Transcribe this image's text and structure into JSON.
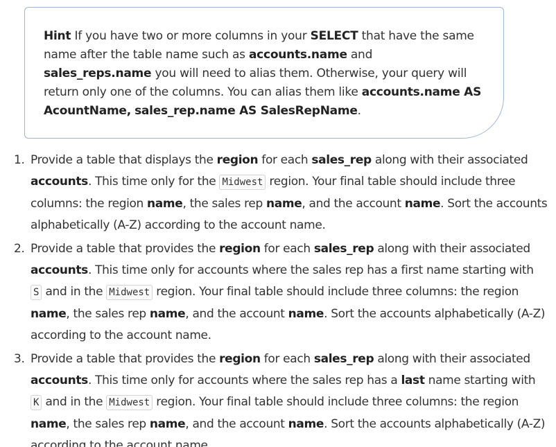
{
  "hint": {
    "label": "Hint",
    "t1": " If you have two or more columns in your ",
    "b1": "SELECT",
    "t2": " that have the same name after the table name such as ",
    "b2": "accounts.name",
    "t3": " and ",
    "b3": "sales_reps.name",
    "t4": " you will need to alias them. Otherwise, your query will return only one of the columns. You can alias them like ",
    "b4": "accounts.name AS AcountName,",
    "t5": " ",
    "b5": "sales_rep.name AS SalesRepName",
    "t6": "."
  },
  "tasks": [
    {
      "num": "1.",
      "p1": "Provide a table that displays the ",
      "b1": "region",
      "p2": " for each ",
      "b2": "sales_rep",
      "p3": " along with their associated ",
      "b3": "accounts",
      "p4": ". This time only for the ",
      "c1": "Midwest",
      "p5": " region. Your final table should include three columns: the region ",
      "b4": "name",
      "p6": ", the sales rep ",
      "b5": "name",
      "p7": ", and the account ",
      "b6": "name",
      "p8": ". Sort the accounts alphabetically (A-Z) according to the account name."
    },
    {
      "num": "2.",
      "p1": "Provide a table that provides the ",
      "b1": "region",
      "p2": " for each ",
      "b2": "sales_rep",
      "p3": " along with their associated ",
      "b3": "accounts",
      "p4": ". This time only for accounts where the sales rep has a first name starting with ",
      "c1": "S",
      "p5": " and in the ",
      "c2": "Midwest",
      "p6": " region. Your final table should include three columns: the region ",
      "b4": "name",
      "p7": ", the sales rep ",
      "b5": "name",
      "p8": ", and the account ",
      "b6": "name",
      "p9": ". Sort the accounts alphabetically (A-Z) according to the account name."
    },
    {
      "num": "3.",
      "p1": "Provide a table that provides the ",
      "b1": "region",
      "p2": " for each ",
      "b2": "sales_rep",
      "p3": " along with their associated ",
      "b3": "accounts",
      "p4": ". This time only for accounts where the sales rep has a ",
      "b4": "last",
      "p5": " name starting with ",
      "c1": "K",
      "p6": " and in the ",
      "c2": "Midwest",
      "p7": " region. Your final table should include three columns: the region ",
      "b5": "name",
      "p8": ", the sales rep ",
      "b6": "name",
      "p9": ", and the account ",
      "b7": "name",
      "p10": ". Sort the accounts alphabetically (A-Z) according to the account name."
    }
  ]
}
